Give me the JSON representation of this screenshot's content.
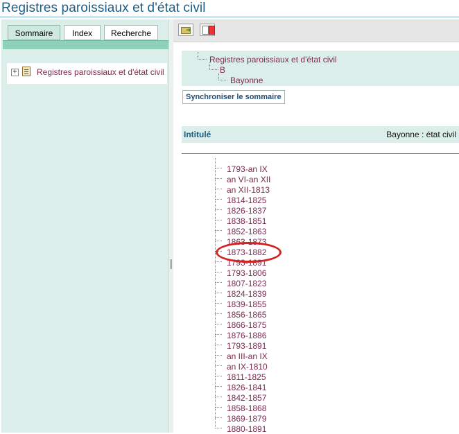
{
  "header": {
    "title": "Registres paroissiaux et d'état civil"
  },
  "left_panel": {
    "tabs": [
      {
        "label": "Sommaire",
        "active": true
      },
      {
        "label": "Index",
        "active": false
      },
      {
        "label": "Recherche",
        "active": false
      }
    ],
    "tree": {
      "expand_glyph": "+",
      "label": "Registres paroissiaux et d'état civil"
    }
  },
  "toolbar": {
    "buttons": [
      {
        "icon": "folder-export-icon"
      },
      {
        "icon": "pdf-export-icon"
      }
    ]
  },
  "breadcrumb": {
    "items": [
      "Registres paroissiaux et d'état civil",
      "B",
      "Bayonne"
    ]
  },
  "sync_button_label": "Synchroniser le sommaire",
  "intitule": {
    "label": "Intitulé",
    "value": "Bayonne : état civil"
  },
  "year_list": [
    "1793-an IX",
    "an VI-an XII",
    "an XII-1813",
    "1814-1825",
    "1826-1837",
    "1838-1851",
    "1852-1863",
    "1863-1873",
    "1873-1882",
    "1793-1891",
    "1793-1806",
    "1807-1823",
    "1824-1839",
    "1839-1855",
    "1856-1865",
    "1866-1875",
    "1876-1886",
    "1793-1891",
    "an III-an IX",
    "an IX-1810",
    "1811-1825",
    "1826-1841",
    "1842-1857",
    "1858-1868",
    "1869-1879",
    "1880-1891"
  ],
  "highlighted_item": "1873-1882",
  "colors": {
    "link": "#7a2a4e",
    "panel": "#dceee9",
    "title": "#1f5d84",
    "highlight": "#d4201f"
  }
}
